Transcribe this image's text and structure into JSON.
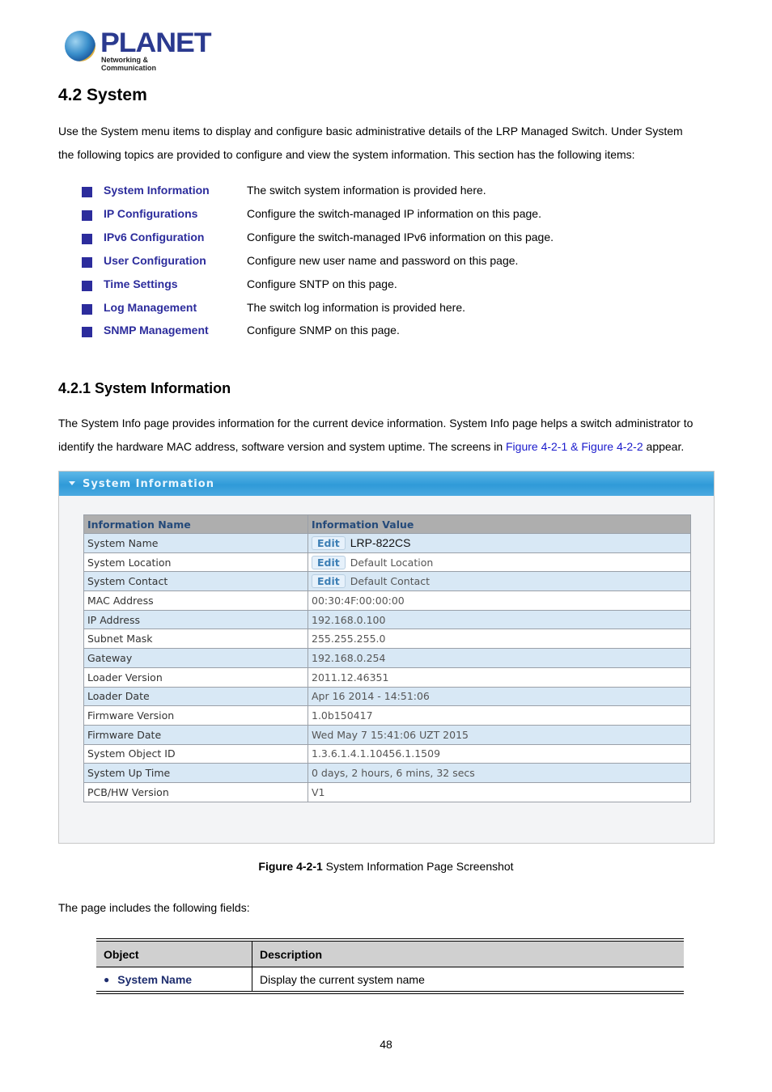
{
  "logo": {
    "brand": "PLANET",
    "tagline": "Networking & Communication"
  },
  "section": {
    "title": "4.2 System",
    "intro_line1": "Use the System menu items to display and configure basic administrative details of the LRP Managed Switch. Under System",
    "intro_line2": "the following topics are provided to configure and view the system information. This section has the following items:",
    "topics": [
      {
        "name": "System Information",
        "desc": "The switch system information is provided here."
      },
      {
        "name": "IP Configurations",
        "desc": "Configure the switch-managed IP information on this page."
      },
      {
        "name": "IPv6 Configuration",
        "desc": "Configure the switch-managed IPv6 information on this page."
      },
      {
        "name": "User Configuration",
        "desc": "Configure new user name and password on this page."
      },
      {
        "name": "Time Settings",
        "desc": "Configure SNTP on this page."
      },
      {
        "name": "Log Management",
        "desc": "The switch log information is provided here."
      },
      {
        "name": "SNMP Management",
        "desc": "Configure SNMP on this page."
      }
    ]
  },
  "subsection": {
    "title": "4.2.1 System Information",
    "para_line1": "The System Info page provides information for the current device information. System Info page helps a switch administrator to",
    "para_line2_pre": "identify the hardware MAC address, software version and system uptime. The screens in ",
    "para_line2_link": "Figure 4-2-1 & Figure 4-2-2",
    "para_line2_post": " appear."
  },
  "screenshot": {
    "panel_title": "System Information",
    "col_name": "Information Name",
    "col_value": "Information Value",
    "edit_label": "Edit",
    "rows": [
      {
        "name": "System Name",
        "value": "LRP-822CS"
      },
      {
        "name": "System Location",
        "value": "Default Location"
      },
      {
        "name": "System Contact",
        "value": "Default Contact"
      },
      {
        "name": "MAC Address",
        "value": "00:30:4F:00:00:00"
      },
      {
        "name": "IP Address",
        "value": "192.168.0.100"
      },
      {
        "name": "Subnet Mask",
        "value": "255.255.255.0"
      },
      {
        "name": "Gateway",
        "value": "192.168.0.254"
      },
      {
        "name": "Loader Version",
        "value": "2011.12.46351"
      },
      {
        "name": "Loader Date",
        "value": "Apr 16 2014 - 14:51:06"
      },
      {
        "name": "Firmware Version",
        "value": "1.0b150417"
      },
      {
        "name": "Firmware Date",
        "value": "Wed May 7 15:41:06 UZT 2015"
      },
      {
        "name": "System Object ID",
        "value": "1.3.6.1.4.1.10456.1.1509"
      },
      {
        "name": "System Up Time",
        "value": "0 days, 2 hours, 6 mins, 32 secs"
      },
      {
        "name": "PCB/HW Version",
        "value": "V1"
      }
    ]
  },
  "caption": {
    "bold": "Figure 4-2-1",
    "text": " System Information Page Screenshot"
  },
  "fields_intro": "The page includes the following fields:",
  "fields_table": {
    "col_object": "Object",
    "col_description": "Description",
    "rows": [
      {
        "object": "System Name",
        "description": "Display the current system name"
      }
    ]
  },
  "page_number": "48"
}
